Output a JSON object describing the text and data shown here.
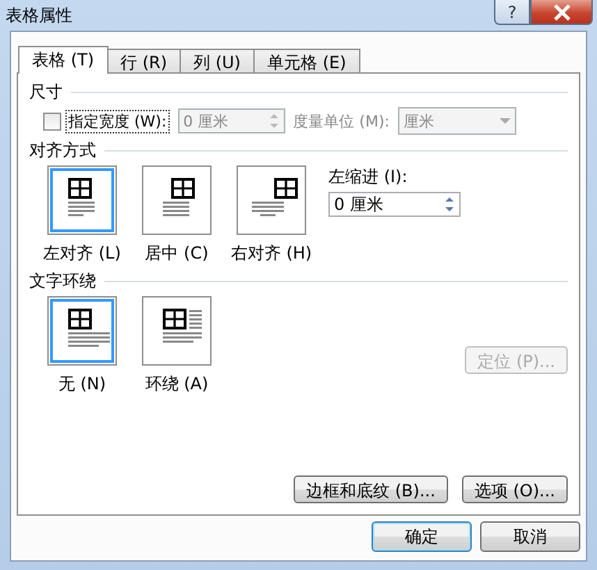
{
  "window": {
    "title": "表格属性",
    "help_button": "?"
  },
  "tabs": [
    {
      "label": "表格 (T)",
      "selected": true
    },
    {
      "label": "行 (R)",
      "selected": false
    },
    {
      "label": "列 (U)",
      "selected": false
    },
    {
      "label": "单元格 (E)",
      "selected": false
    }
  ],
  "size": {
    "heading": "尺寸",
    "width_checkbox": {
      "label": "指定宽度 (W):",
      "checked": false
    },
    "width_field": {
      "value": "0 厘米",
      "disabled": true
    },
    "unit_label": "度量单位 (M):",
    "unit_dropdown": {
      "value": "厘米",
      "disabled": true
    }
  },
  "alignment": {
    "heading": "对齐方式",
    "options": [
      {
        "kind": "align-left",
        "label": "左对齐 (L)",
        "selected": true
      },
      {
        "kind": "align-center",
        "label": "居中 (C)",
        "selected": false
      },
      {
        "kind": "align-right",
        "label": "右对齐 (H)",
        "selected": false
      }
    ],
    "indent_label": "左缩进 (I):",
    "indent_field": {
      "value": "0 厘米"
    }
  },
  "text_wrapping": {
    "heading": "文字环绕",
    "options": [
      {
        "kind": "wrap-none",
        "label": "无 (N)",
        "selected": true
      },
      {
        "kind": "wrap-around",
        "label": "环绕 (A)",
        "selected": false
      }
    ],
    "position_button": {
      "label": "定位 (P)...",
      "disabled": true
    }
  },
  "panel_buttons": [
    "边框和底纹 (B)...",
    "选项 (O)..."
  ],
  "dialog_buttons": [
    {
      "label": "确定",
      "default": true
    },
    {
      "label": "取消",
      "default": false
    }
  ]
}
